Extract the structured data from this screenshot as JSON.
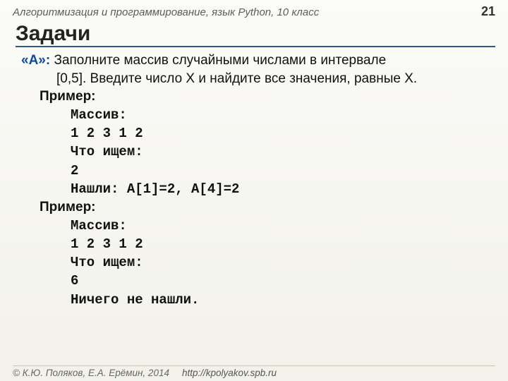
{
  "header": {
    "course": "Алгоритмизация и программирование, язык Python, 10 класс",
    "page": "21"
  },
  "title": "Задачи",
  "task": {
    "label": "«A»:",
    "line1": "Заполните массив случайными числами в интервале",
    "line2": "[0,5]. Введите число X и найдите все значения, равные X."
  },
  "ex_label": "Пример:",
  "ex1": {
    "l1": "Массив:",
    "l2": "1 2 3 1 2",
    "l3": "Что ищем:",
    "l4": "2",
    "l5": "Нашли: A[1]=2, A[4]=2"
  },
  "ex2": {
    "l1": "Массив:",
    "l2": "1 2 3 1 2",
    "l3": "Что ищем:",
    "l4": "6",
    "l5": "Ничего не нашли."
  },
  "footer": {
    "copy": "© К.Ю. Поляков, Е.А. Ерёмин, 2014",
    "url": "http://kpolyakov.spb.ru"
  }
}
